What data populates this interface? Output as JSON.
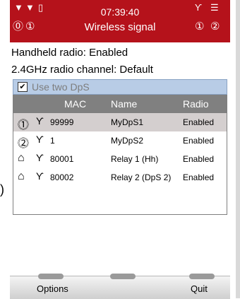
{
  "status": {
    "time": "07:39:40",
    "title": "Wireless signal",
    "icons": [
      "signal-bars-icon",
      "signal-bars-icon",
      "battery-icon",
      "radio-1-icon",
      "radio-2-icon",
      "antenna-icon",
      "menu-lines-icon"
    ]
  },
  "info": {
    "handheld_radio": "Handheld radio: Enabled",
    "channel": "2.4GHz radio channel: Default"
  },
  "checkbox": {
    "checked": true,
    "label": "Use two DpS"
  },
  "table": {
    "headers": {
      "mac": "MAC",
      "name": "Name",
      "radio": "Radio"
    },
    "rows": [
      {
        "device": "dps-1-icon",
        "mac": "99999",
        "name": "MyDpS1",
        "radio": "Enabled",
        "selected": true
      },
      {
        "device": "dps-2-icon",
        "mac": "1",
        "name": "MyDpS2",
        "radio": "Enabled",
        "selected": false
      },
      {
        "device": "relay-icon",
        "mac": "80001",
        "name": "Relay 1 (Hh)",
        "radio": "Enabled",
        "selected": false
      },
      {
        "device": "relay-icon",
        "mac": "80002",
        "name": "Relay 2 (DpS 2)",
        "radio": "Enabled",
        "selected": false
      }
    ]
  },
  "softkeys": {
    "left": "Options",
    "right": "Quit"
  },
  "colors": {
    "titlebar": "#b5121b",
    "header": "#808080",
    "selected_row": "#d4cfcf",
    "checkbar": "#b8cce6"
  }
}
